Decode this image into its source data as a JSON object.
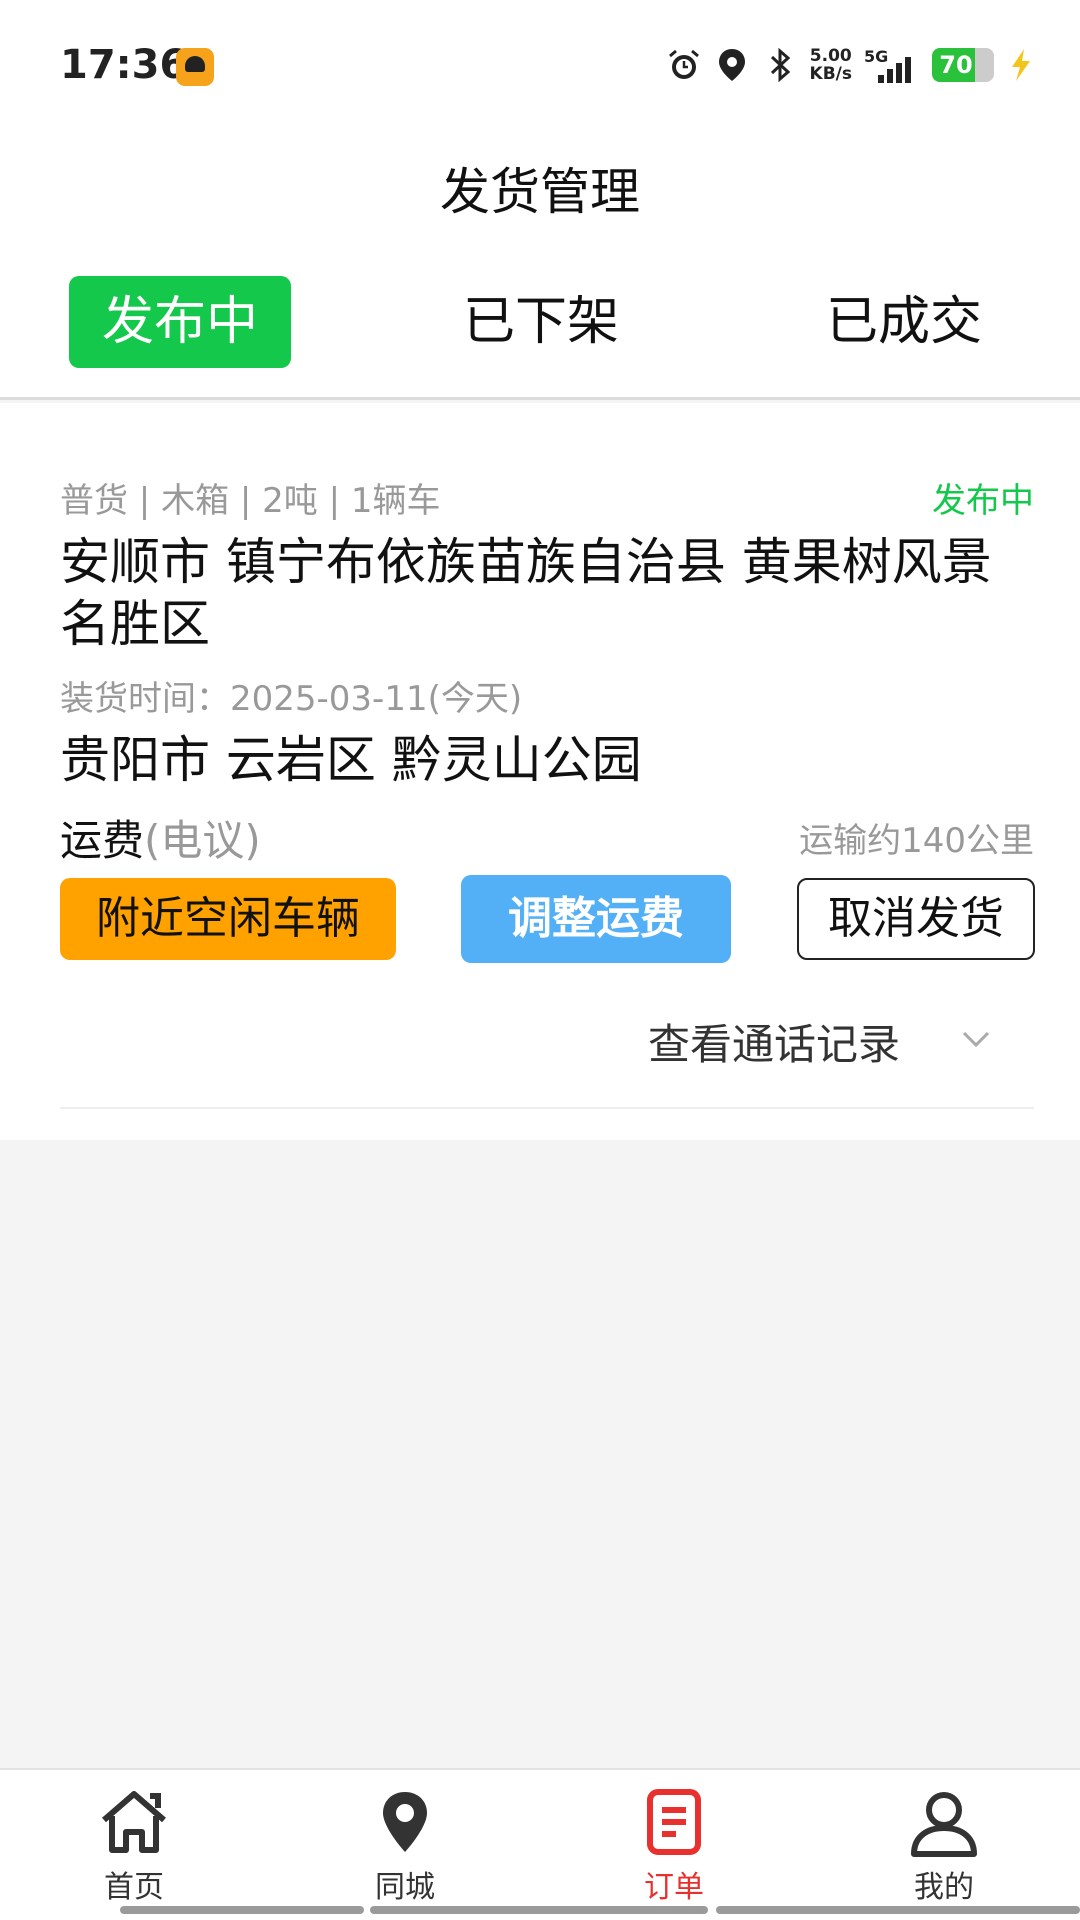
{
  "status_bar": {
    "time": "17:36",
    "speed": "5.00",
    "speed_unit": "KB/s",
    "network": "5G",
    "battery": "70",
    "icons": [
      "app-icon",
      "alarm-icon",
      "location-icon",
      "bluetooth-icon",
      "signal-icon",
      "battery-icon",
      "charging-icon"
    ]
  },
  "header": {
    "title": "发货管理"
  },
  "tabs": [
    {
      "label": "发布中",
      "active": true
    },
    {
      "label": "已下架",
      "active": false
    },
    {
      "label": "已成交",
      "active": false
    }
  ],
  "order": {
    "tags": "普货 | 木箱 | 2吨 | 1辆车",
    "status": "发布中",
    "origin": "安顺市 镇宁布依族苗族自治县 黄果树风景名胜区",
    "load_time": "装货时间：2025-03-11(今天)",
    "destination": "贵阳市 云岩区 黔灵山公园",
    "fee_label": "运费",
    "fee_note": "(电议)",
    "distance": "运输约140公里",
    "buttons": {
      "nearby": "附近空闲车辆",
      "adjust": "调整运费",
      "cancel": "取消发货"
    },
    "call_log": "查看通话记录"
  },
  "bottom_nav": [
    {
      "label": "首页",
      "icon": "home-icon",
      "active": false
    },
    {
      "label": "同城",
      "icon": "location-pin-icon",
      "active": false
    },
    {
      "label": "订单",
      "icon": "order-icon",
      "active": true
    },
    {
      "label": "我的",
      "icon": "user-icon",
      "active": false
    }
  ],
  "colors": {
    "accent_green": "#13c84a",
    "orange": "#ffa200",
    "blue": "#53aff6",
    "active_red": "#e8312f"
  }
}
